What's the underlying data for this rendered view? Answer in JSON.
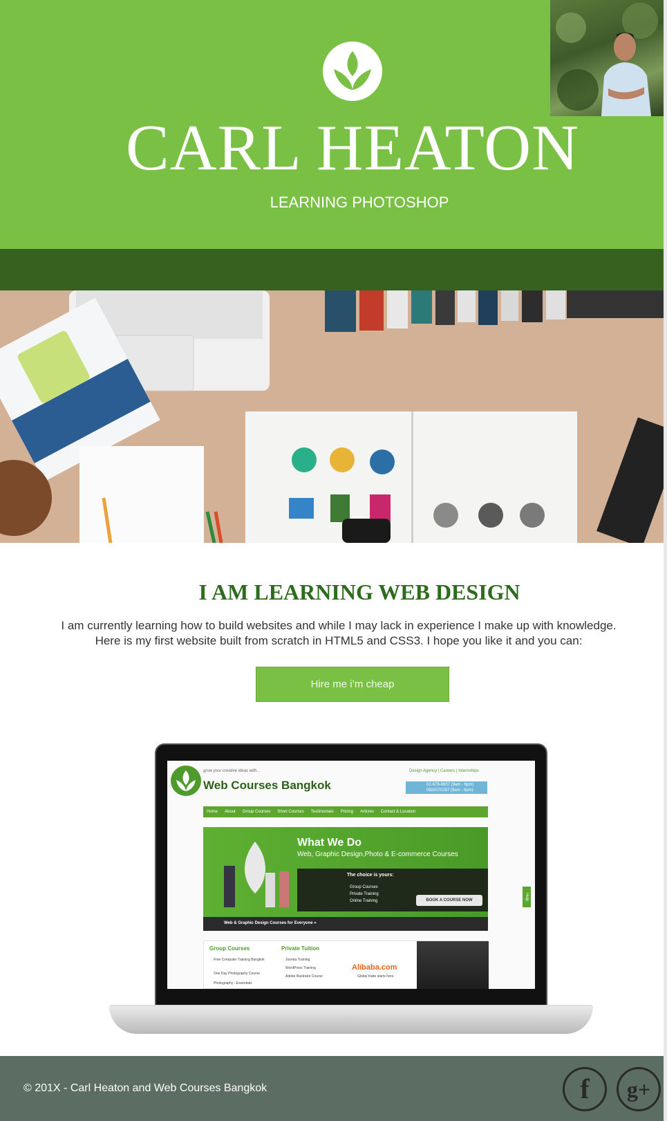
{
  "header": {
    "title": "CARL HEATON",
    "subtitle": "LEARNING PHOTOSHOP",
    "logo_icon": "leaf-logo-icon"
  },
  "main": {
    "heading": "I AM LEARNING WEB DESIGN",
    "intro_line1": "I am currently learning how to build websites and while I may lack in experience I make up with knowledge.",
    "intro_line2": "Here is my first website built from scratch in HTML5 and CSS3. I hope you like it and you can:",
    "cta_label": "Hire me i’m cheap"
  },
  "preview": {
    "tagline": "grow your creative ideas with...",
    "brand": "Web Courses Bangkok",
    "toplinks": [
      "Design Agency",
      "Careers",
      "Internships"
    ],
    "phone1": "02-679-8607 (9am - 6pm)",
    "phone2": "0920070287 (9am - 6pm)",
    "nav": [
      "Home",
      "About",
      "Group Courses",
      "Short Courses",
      "Testimonials",
      "Pricing",
      "Articles",
      "Contact & Location"
    ],
    "banner_title": "What We Do",
    "banner_sub": "Web, Graphic Design,Photo & E-commerce Courses",
    "choice_title": "The choice is yours:",
    "choices": [
      "Group Courses",
      "Private Training",
      "Online Training"
    ],
    "book_button": "BOOK A COURSE NOW",
    "strip_text": "Web & Graphic Design Courses for Everyone »",
    "help_tab": "Help",
    "col1_title": "Group Courses",
    "col1_items": [
      "Free Computer Training Bangkok",
      "One Day Photography Course",
      "Photography - Essentials"
    ],
    "col2_title": "Private Tuition",
    "col2_items": [
      "Joomla Training",
      "WordPress Training",
      "Adobe Illustrator Course"
    ],
    "ad_brand": "Alibaba.com",
    "ad_tagline": "Global trade starts here."
  },
  "footer": {
    "copyright": "© 201X - Carl Heaton and Web Courses Bangkok",
    "facebook_glyph": "f",
    "google_glyph": "g+"
  },
  "colors": {
    "brand_green": "#79c045",
    "dark_green": "#36611e",
    "heading_green": "#2f6b1e",
    "footer_gray": "#5c6d63"
  }
}
